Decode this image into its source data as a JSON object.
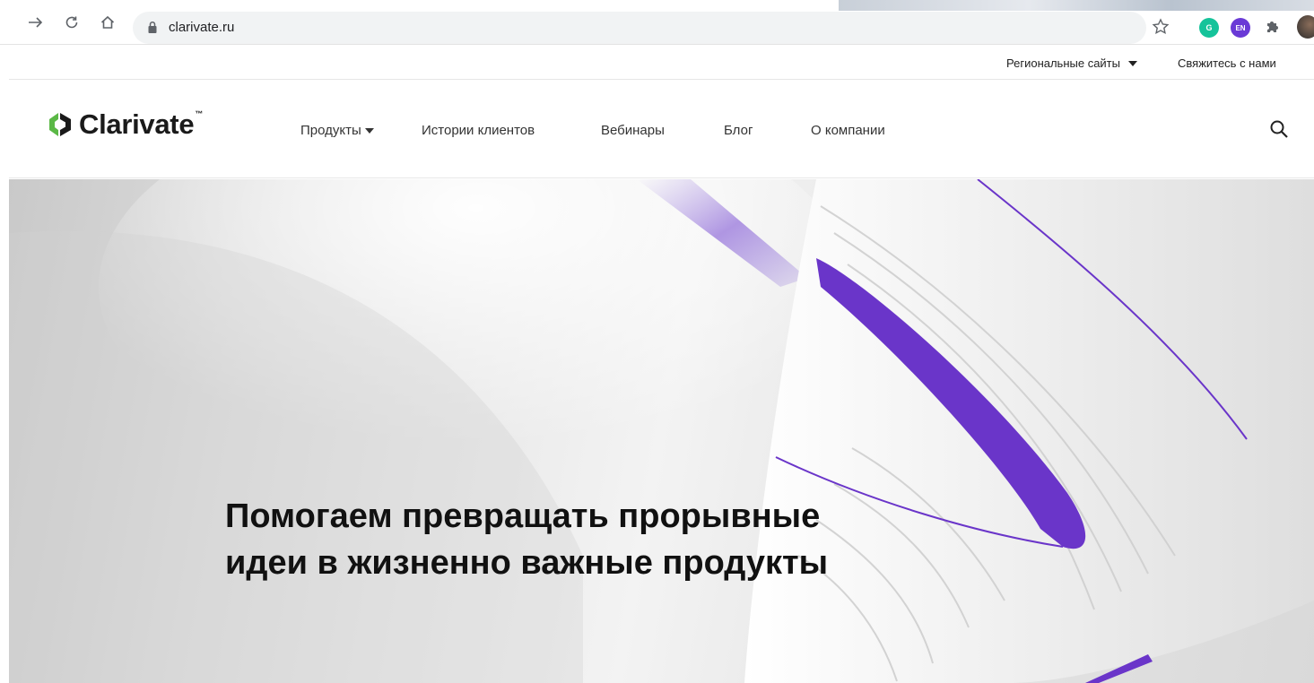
{
  "browser": {
    "url": "clarivate.ru",
    "extensions": [
      {
        "name": "grammarly",
        "label": "G",
        "color": "#15c39a"
      },
      {
        "name": "language",
        "label": "EN",
        "color": "#6a3ad6"
      }
    ]
  },
  "utility_nav": {
    "regional_label": "Региональные сайты",
    "contact_label": "Свяжитесь с нами"
  },
  "header": {
    "logo_text": "Clarivate",
    "logo_tm": "™",
    "nav": [
      {
        "label": "Продукты"
      },
      {
        "label": "Истории клиентов"
      },
      {
        "label": "Вебинары"
      },
      {
        "label": "Блог"
      },
      {
        "label": "О компании"
      }
    ]
  },
  "hero": {
    "title_line1": "Помогаем превращать прорывные",
    "title_line2": "идеи в жизненно важные продукты"
  },
  "colors": {
    "accent_purple": "#6a35c9",
    "logo_green": "#5bb846",
    "logo_dark": "#1a1a1a"
  }
}
